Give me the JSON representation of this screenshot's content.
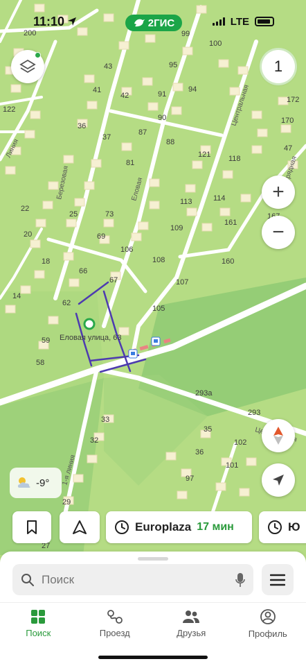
{
  "status": {
    "time": "11:10",
    "brand": "2ГИС",
    "network": "LTE"
  },
  "map": {
    "house_numbers": [
      "200",
      "99",
      "100",
      "43",
      "95",
      "41",
      "42",
      "91",
      "94",
      "122",
      "36",
      "87",
      "90",
      "88",
      "37",
      "81",
      "121",
      "118",
      "22",
      "25",
      "73",
      "113",
      "114",
      "20",
      "69",
      "109",
      "161",
      "106",
      "18",
      "66",
      "108",
      "160",
      "107",
      "67",
      "14",
      "62",
      "105",
      "59",
      "58",
      "293а",
      "293",
      "33",
      "35",
      "102",
      "32",
      "36",
      "101",
      "97",
      "29",
      "27",
      "172",
      "170",
      "167",
      "47"
    ],
    "streets": [
      "Березовая",
      "Еловая",
      "Центральная",
      "Линия",
      "Нарядная",
      "1-я линия",
      "Центральная"
    ],
    "place_label": "Еловая улица, 63"
  },
  "controls": {
    "layers_icon": "layers-icon",
    "count_badge": "1",
    "zoom_in": "+",
    "zoom_out": "−",
    "compass_icon": "compass-icon",
    "locate_icon": "locate-arrow-icon"
  },
  "weather": {
    "temp": "-9°",
    "icon": "partly-cloudy-icon"
  },
  "chips": {
    "bookmark_icon": "bookmark-icon",
    "navigation_icon": "navigation-icon",
    "routes": [
      {
        "name": "Europlaza",
        "time": "17 мин",
        "icon": "clock-icon"
      },
      {
        "name": "Ю",
        "time": "",
        "icon": "clock-icon"
      }
    ]
  },
  "search": {
    "placeholder": "Поиск"
  },
  "tabs": [
    {
      "label": "Поиск",
      "icon": "grid-icon",
      "active": true
    },
    {
      "label": "Проезд",
      "icon": "route-icon",
      "active": false
    },
    {
      "label": "Друзья",
      "icon": "friends-icon",
      "active": false
    },
    {
      "label": "Профиль",
      "icon": "profile-icon",
      "active": false
    }
  ],
  "colors": {
    "accent": "#2a9a3b",
    "map_bg": "#b5dc84",
    "forest": "#86c46c",
    "road": "#ffffff",
    "building": "#f6f0d2"
  }
}
